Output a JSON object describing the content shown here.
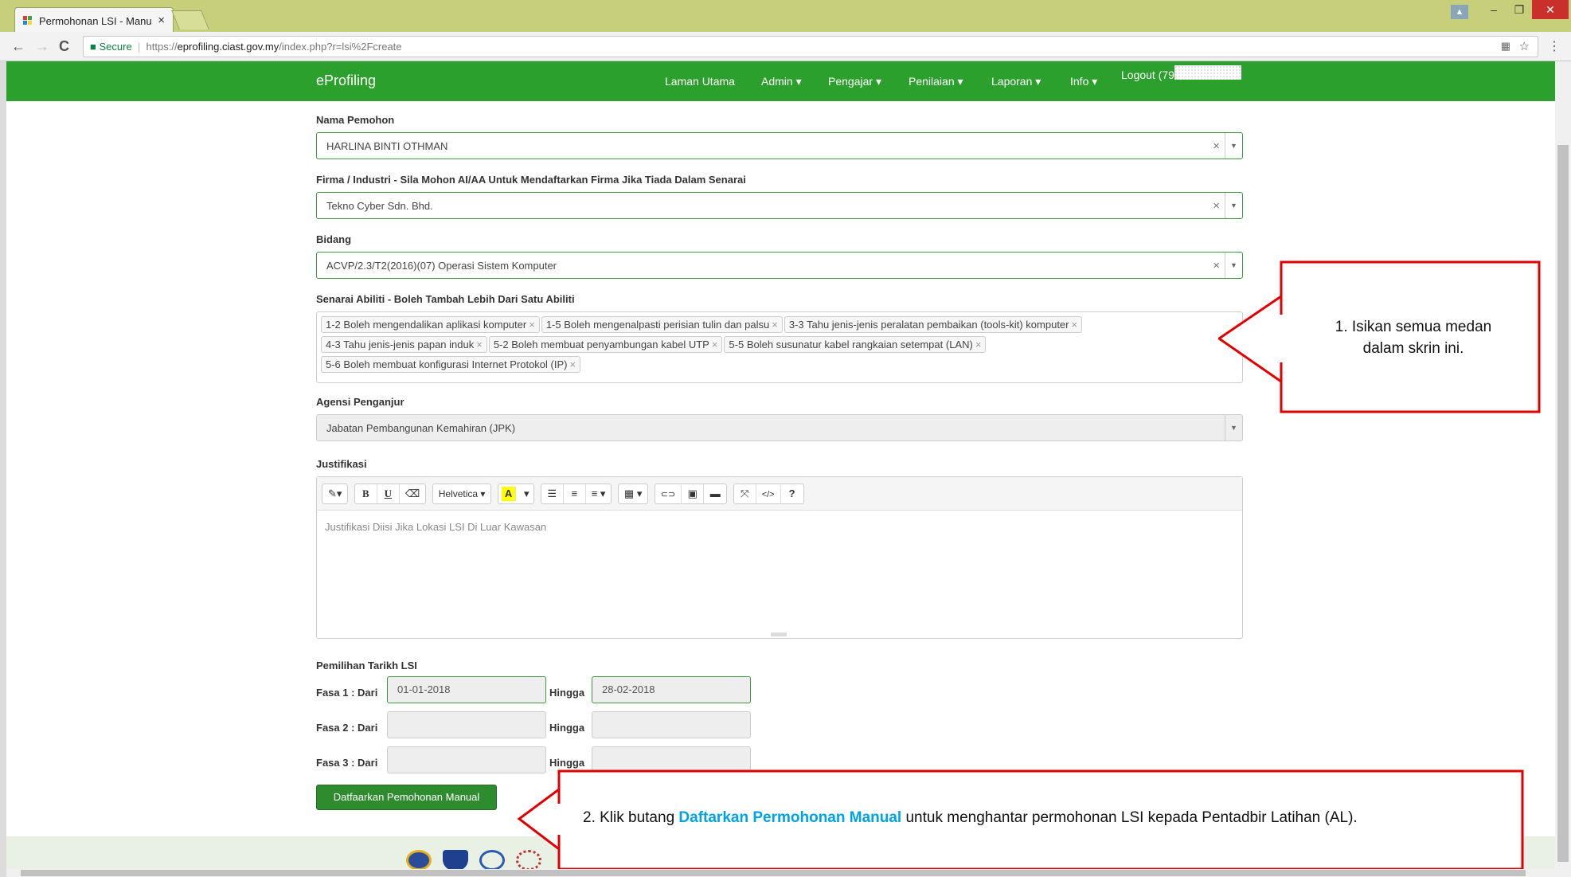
{
  "browser": {
    "tab_title": "Permohonan LSI - Manu",
    "close_tab": "×",
    "secure_label": "Secure",
    "url_scheme": "https://",
    "url_host": "eprofiling.ciast.gov.my",
    "url_path": "/index.php?r=lsi%2Fcreate",
    "back_icon": "←",
    "forward_icon": "→",
    "reload_icon": "C",
    "win_minimize": "–",
    "win_restore": "❐",
    "win_close": "✕"
  },
  "navbar": {
    "brand": "eProfiling",
    "items": [
      "Laman Utama",
      "Admin",
      "Pengajar",
      "Penilaian",
      "Laporan",
      "Info"
    ],
    "caret": "▾",
    "logout": "Logout (79",
    "color": "#2ca02c"
  },
  "form": {
    "nama_label": "Nama Pemohon",
    "nama_value": "HARLINA BINTI OTHMAN",
    "firma_label": "Firma / Industri - Sila Mohon AI/AA Untuk Mendaftarkan Firma Jika Tiada Dalam Senarai",
    "firma_value": "Tekno Cyber Sdn. Bhd.",
    "bidang_label": "Bidang",
    "bidang_value": "ACVP/2.3/T2(2016)(07) Operasi Sistem Komputer",
    "abiliti_label": "Senarai Abiliti - Boleh Tambah Lebih Dari Satu Abiliti",
    "abiliti": [
      "1-2 Boleh mengendalikan aplikasi komputer",
      "1-5 Boleh mengenalpasti perisian tulin dan palsu",
      "3-3 Tahu jenis-jenis peralatan pembaikan (tools-kit) komputer",
      "4-3 Tahu jenis-jenis papan induk",
      "5-2 Boleh membuat penyambungan kabel UTP",
      "5-5 Boleh susunatur kabel rangkaian setempat (LAN)",
      "5-6 Boleh membuat konfigurasi Internet Protokol (IP)"
    ],
    "clear_symbol": "×",
    "dropdown_symbol": "▼",
    "agensi_label": "Agensi Penganjur",
    "agensi_value": "Jabatan Pembangunan Kemahiran (JPK)",
    "justifikasi_label": "Justifikasi",
    "editor_placeholder": "Justifikasi Diisi Jika Lokasi LSI Di Luar Kawasan",
    "toolbar": {
      "magic": "✎▾",
      "bold": "B",
      "underline": "U",
      "eraser": "⌫",
      "font": "Helvetica ▾",
      "color": "A",
      "color_caret": "▾",
      "ul": "☰",
      "ol": "≡",
      "align": "≡ ▾",
      "table": "▦ ▾",
      "link": "⊂⊃",
      "picture": "▣",
      "video": "▬",
      "fullscreen": "⤧",
      "code": "</>",
      "help": "?"
    },
    "tarikh_label": "Pemilihan Tarikh LSI",
    "fasa": [
      {
        "label": "Fasa 1 : Dari",
        "from": "01-01-2018",
        "to_label": "Hingga",
        "to": "28-02-2018"
      },
      {
        "label": "Fasa 2 : Dari",
        "from": "",
        "to_label": "Hingga",
        "to": ""
      },
      {
        "label": "Fasa 3 : Dari",
        "from": "",
        "to_label": "Hingga",
        "to": ""
      }
    ],
    "submit_label": "Datfaarkan Pemohonan Manual"
  },
  "callouts": {
    "first_line1": "1. Isikan semua medan",
    "first_line2": "dalam skrin ini.",
    "second_prefix": "2. Klik butang ",
    "second_highlight": "Daftarkan Permohonan Manual",
    "second_suffix": " untuk menghantar permohonan LSI kepada Pentadbir Latihan (AL).",
    "border_color": "#e00000",
    "highlight_color": "#00a2e8"
  }
}
